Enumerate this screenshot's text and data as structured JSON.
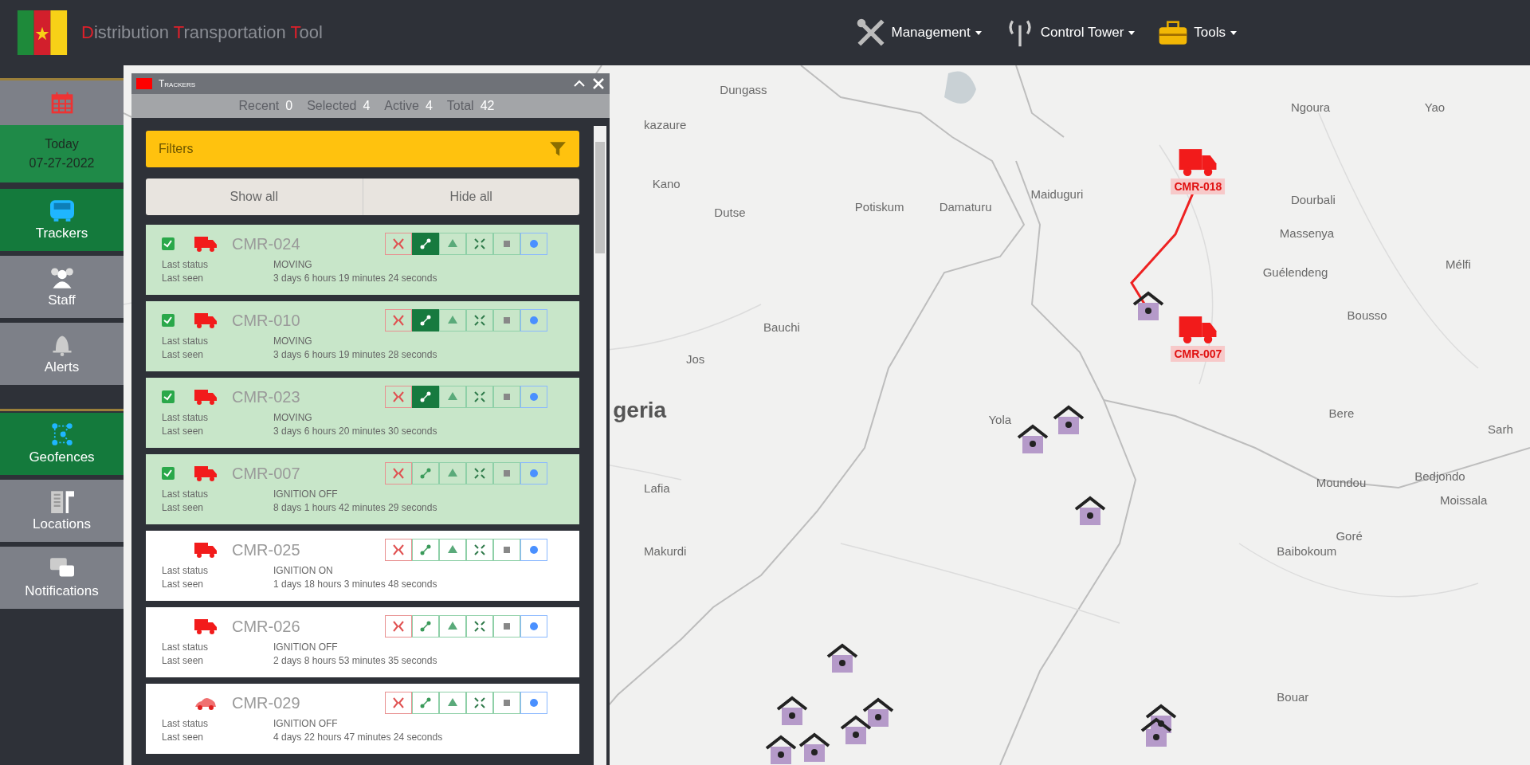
{
  "header": {
    "title": "Distribution Transportation Tool",
    "menus": [
      {
        "label": "Management",
        "kind": "tools"
      },
      {
        "label": "Control Tower",
        "kind": "antenna"
      },
      {
        "label": "Tools",
        "kind": "toolbox"
      }
    ]
  },
  "sidebar": {
    "date": {
      "label": "Today",
      "value": "07-27-2022"
    },
    "groups": [
      [
        {
          "label": "Trackers",
          "kind": "bus",
          "selected": true
        },
        {
          "label": "Staff",
          "kind": "people",
          "selected": false
        },
        {
          "label": "Alerts",
          "kind": "bell",
          "selected": false
        }
      ],
      [
        {
          "label": "Geofences",
          "kind": "polygon",
          "selected": true
        },
        {
          "label": "Locations",
          "kind": "building",
          "selected": false
        },
        {
          "label": "Notifications",
          "kind": "chat",
          "selected": false
        }
      ]
    ]
  },
  "panel": {
    "title": "Trackers",
    "stats": [
      {
        "label": "Recent",
        "value": "0"
      },
      {
        "label": "Selected",
        "value": "4"
      },
      {
        "label": "Active",
        "value": "4"
      },
      {
        "label": "Total",
        "value": "42"
      }
    ],
    "filters": "Filters",
    "show_all": "Show all",
    "hide_all": "Hide all",
    "trackers": [
      {
        "name": "CMR-024",
        "kind": "truck",
        "checked": true,
        "route_on": true,
        "status_label": "Last status",
        "status": "MOVING",
        "seen_label": "Last seen",
        "seen": "3 days 6 hours 19 minutes 24 seconds"
      },
      {
        "name": "CMR-010",
        "kind": "truck",
        "checked": true,
        "route_on": true,
        "status_label": "Last status",
        "status": "MOVING",
        "seen_label": "Last seen",
        "seen": "3 days 6 hours 19 minutes 28 seconds"
      },
      {
        "name": "CMR-023",
        "kind": "truck",
        "checked": true,
        "route_on": true,
        "status_label": "Last status",
        "status": "MOVING",
        "seen_label": "Last seen",
        "seen": "3 days 6 hours 20 minutes 30 seconds"
      },
      {
        "name": "CMR-007",
        "kind": "truck",
        "checked": true,
        "route_on": false,
        "status_label": "Last status",
        "status": "IGNITION OFF",
        "seen_label": "Last seen",
        "seen": "8 days 1 hours 42 minutes 29 seconds"
      },
      {
        "name": "CMR-025",
        "kind": "truck",
        "checked": false,
        "route_on": false,
        "status_label": "Last status",
        "status": "IGNITION ON",
        "seen_label": "Last seen",
        "seen": "1 days 18 hours 3 minutes 48 seconds"
      },
      {
        "name": "CMR-026",
        "kind": "truck",
        "checked": false,
        "route_on": false,
        "status_label": "Last status",
        "status": "IGNITION OFF",
        "seen_label": "Last seen",
        "seen": "2 days 8 hours 53 minutes 35 seconds"
      },
      {
        "name": "CMR-029",
        "kind": "car",
        "checked": false,
        "route_on": false,
        "status_label": "Last status",
        "status": "IGNITION OFF",
        "seen_label": "Last seen",
        "seen": "4 days 22 hours 47 minutes 24 seconds"
      }
    ]
  },
  "map": {
    "places": [
      "Dungass",
      "Ngoura",
      "Yao",
      "kazaure",
      "Kano",
      "Dutse",
      "Potiskum",
      "Damaturu",
      "Maiduguri",
      "Dourbali",
      "Massenya",
      "Guélendeng",
      "Mélfi",
      "Bousso",
      "Bauchi",
      "Jos",
      "Yola",
      "Bere",
      "Sarh",
      "Lafia",
      "Makurdi",
      "Moundou",
      "Bedjondo",
      "Moissala",
      "Goré",
      "Baibokoum",
      "Bouar"
    ],
    "country": "geria",
    "vehicles": [
      "CMR-018",
      "CMR-007"
    ]
  }
}
